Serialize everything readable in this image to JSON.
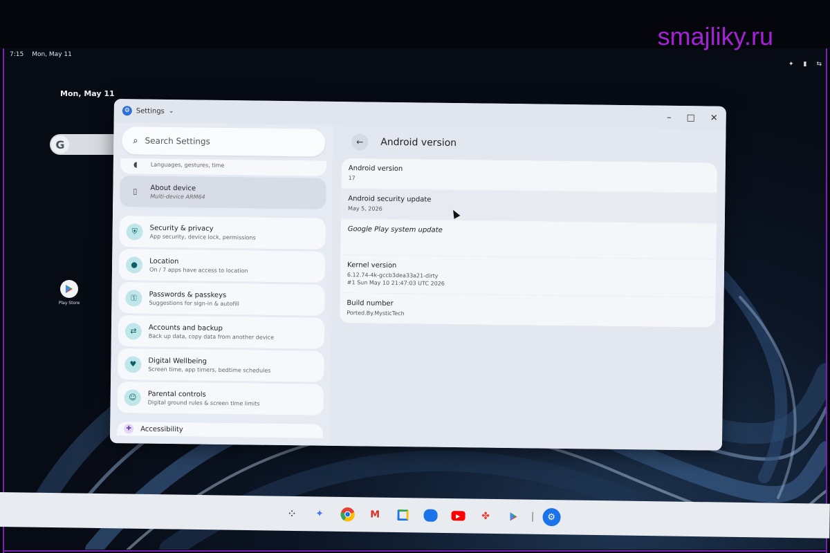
{
  "watermark": "smajliky.ru",
  "status": {
    "time": "7:15",
    "date": "Mon, May 11"
  },
  "desktop": {
    "date": "Mon, May 11",
    "apps": [
      {
        "label": "Play Store",
        "icon": "play-store-icon"
      }
    ]
  },
  "window": {
    "title": "Settings",
    "controls": {
      "minimize": "–",
      "maximize": "□",
      "close": "✕"
    }
  },
  "sidebar": {
    "search_placeholder": "Search Settings",
    "system_subtitle": "Languages, gestures, time",
    "about": {
      "title": "About device",
      "subtitle": "Multi-device ARM64"
    },
    "items": [
      {
        "title": "Security & privacy",
        "subtitle": "App security, device lock, permissions",
        "icon": "shield-icon"
      },
      {
        "title": "Location",
        "subtitle": "On / 7 apps have access to location",
        "icon": "location-pin-icon"
      },
      {
        "title": "Passwords & passkeys",
        "subtitle": "Suggestions for sign-in & autofill",
        "icon": "key-icon"
      },
      {
        "title": "Accounts and backup",
        "subtitle": "Back up data, copy data from another device",
        "icon": "sync-icon"
      },
      {
        "title": "Digital Wellbeing",
        "subtitle": "Screen time, app timers, bedtime schedules",
        "icon": "wellbeing-icon"
      },
      {
        "title": "Parental controls",
        "subtitle": "Digital ground rules & screen time limits",
        "icon": "parental-icon"
      }
    ],
    "partial_item": "Accessibility"
  },
  "content": {
    "title": "Android version",
    "rows": [
      {
        "key": "Android version",
        "value": "17"
      },
      {
        "key": "Android security update",
        "value": "May 5, 2026"
      },
      {
        "key": "Google Play system update",
        "value": ""
      },
      {
        "key": "Kernel version",
        "value": "6.12.74-4k-gccb3dea33a21-dirty",
        "value2": "#1 Sun May 10 21:47:03 UTC 2026"
      },
      {
        "key": "Build number",
        "value": "Ported.By.MysticTech"
      }
    ]
  },
  "taskbar": {
    "icons": [
      "launcher-icon",
      "gemini-icon",
      "chrome-icon",
      "gmail-icon",
      "calendar-icon",
      "files-icon",
      "youtube-icon",
      "photos-icon",
      "play-store-icon",
      "settings-icon"
    ],
    "colors": {
      "chrome": "#e34133",
      "gmail": "#d93025",
      "files": "#1a73e8",
      "youtube": "#ff0000",
      "settings": "#1a73e8"
    }
  }
}
